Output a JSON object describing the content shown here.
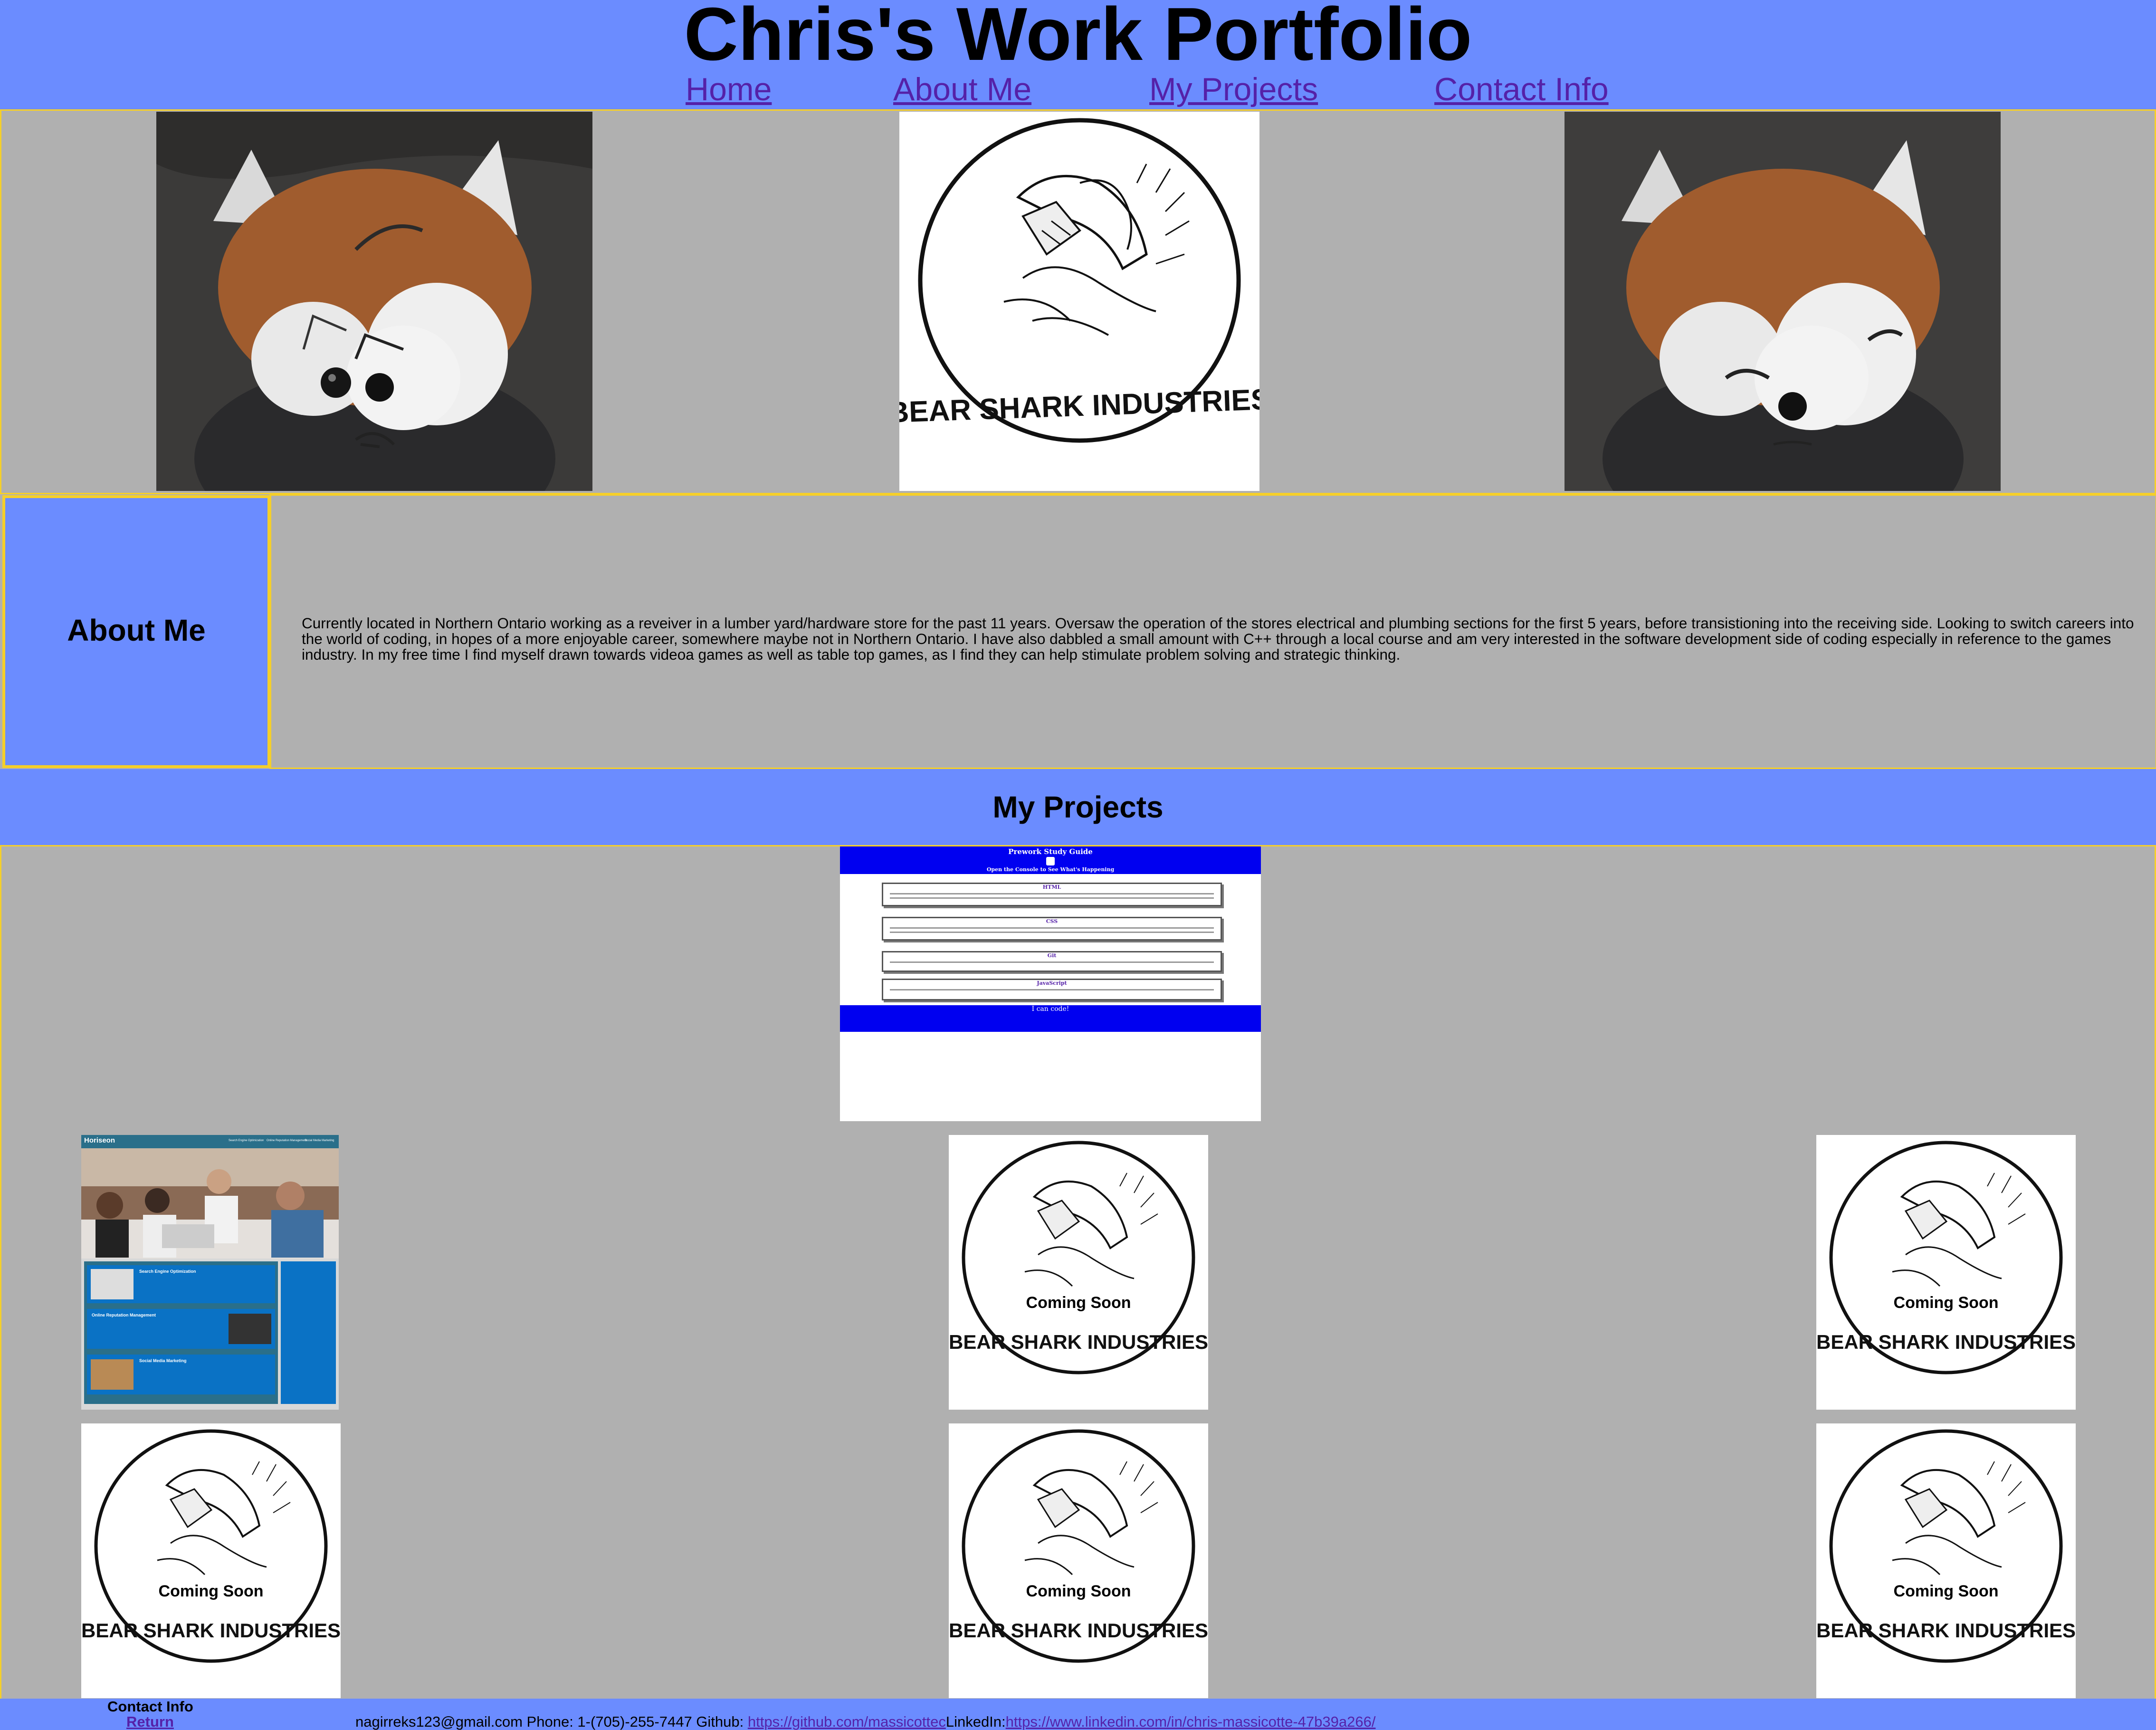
{
  "header": {
    "title": "Chris's Work Portfolio",
    "nav": [
      {
        "label": "Home"
      },
      {
        "label": "About Me"
      },
      {
        "label": "My Projects"
      },
      {
        "label": "Contact Info"
      }
    ]
  },
  "hero": {
    "logo_text": "BEAR SHARK INDUSTRIES"
  },
  "about": {
    "heading": "About Me",
    "text": "Currently located in Northern Ontario working as a reveiver in a lumber yard/hardware store for the past 11 years. Oversaw the operation of the stores electrical and plumbing sections for the first 5 years, before transistioning into the receiving side. Looking to switch careers into the world of coding, in hopes of a more enjoyable career, somewhere maybe not in Northern Ontario. I have also dabbled a small amount with C++ through a local course and am very interested in the software development side of coding especially in reference to the games industry. In my free time I find myself drawn towards videoa games as well as table top games, as I find they can help stimulate problem solving and strategic thinking."
  },
  "projects": {
    "heading": "My Projects",
    "study_guide": {
      "title": "Prework Study Guide",
      "subtitle": "Open the Console to See What's Happening",
      "sections": [
        "HTML",
        "CSS",
        "Git",
        "JavaScript"
      ],
      "footer": "I can code!"
    },
    "horiseon": {
      "brand": "Horiseon",
      "nav": [
        "Search Engine Optimization",
        "Online Reputation Management",
        "Social Media Marketing"
      ],
      "cards": [
        "Search Engine Optimization",
        "Online Reputation Management",
        "Social Media Marketing"
      ]
    },
    "coming_soon_label": "Coming Soon"
  },
  "footer": {
    "heading": "Contact Info",
    "return_label": "Return",
    "email_and_phone": "nagirreks123@gmail.com Phone:    1-(705)-255-7447 Github:   ",
    "github_url": "https://github.com/massicottec",
    "linkedin_label": "LinkedIn:",
    "linkedin_url": "https://www.linkedin.com/in/chris-massicotte-47b39a266/"
  },
  "colors": {
    "header_blue": "#6b8cff",
    "page_gray": "#b0b0b0",
    "border_yellow": "#f5cf2a",
    "link_purple": "#5521a8",
    "study_guide_blue": "#0000f0"
  }
}
